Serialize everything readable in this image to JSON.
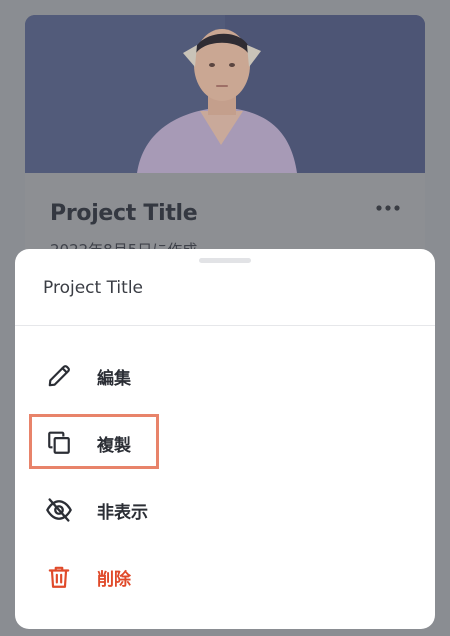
{
  "card": {
    "title": "Project Title",
    "date": "2022年8月5日に作成",
    "more_icon": "more-horizontal-icon"
  },
  "sheet": {
    "title": "Project Title",
    "items": [
      {
        "label": "編集",
        "icon": "pencil-icon"
      },
      {
        "label": "複製",
        "icon": "copy-icon"
      },
      {
        "label": "非表示",
        "icon": "eye-off-icon"
      },
      {
        "label": "削除",
        "icon": "trash-icon",
        "color": "#e04a2a"
      }
    ]
  },
  "colors": {
    "overlay": "#8a8d92",
    "danger": "#e04a2a",
    "highlight": "#e8836a"
  }
}
